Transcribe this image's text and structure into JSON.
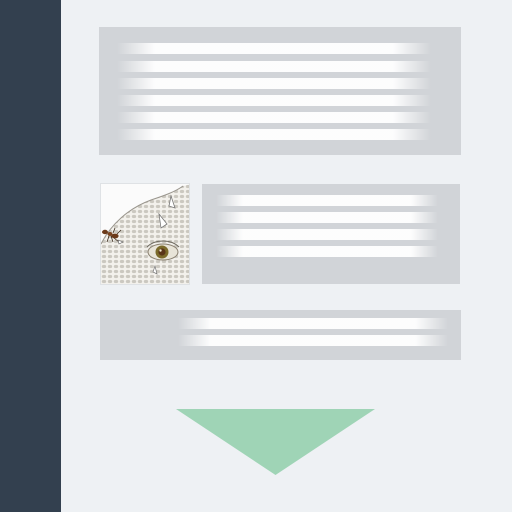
{
  "colors": {
    "sidebar": "#33404f",
    "background": "#eef1f4",
    "card": "#d1d4d8",
    "placeholder_line": "#ffffff",
    "arrow": "#9fd4b6"
  },
  "top_card": {
    "placeholder_lines": 6
  },
  "media_card": {
    "image_icon": "lizard-eye-sketch-icon",
    "placeholder_lines": 4
  },
  "bottom_card": {
    "placeholder_lines": 2
  },
  "arrow": {
    "icon": "down-triangle-icon",
    "direction": "down"
  }
}
